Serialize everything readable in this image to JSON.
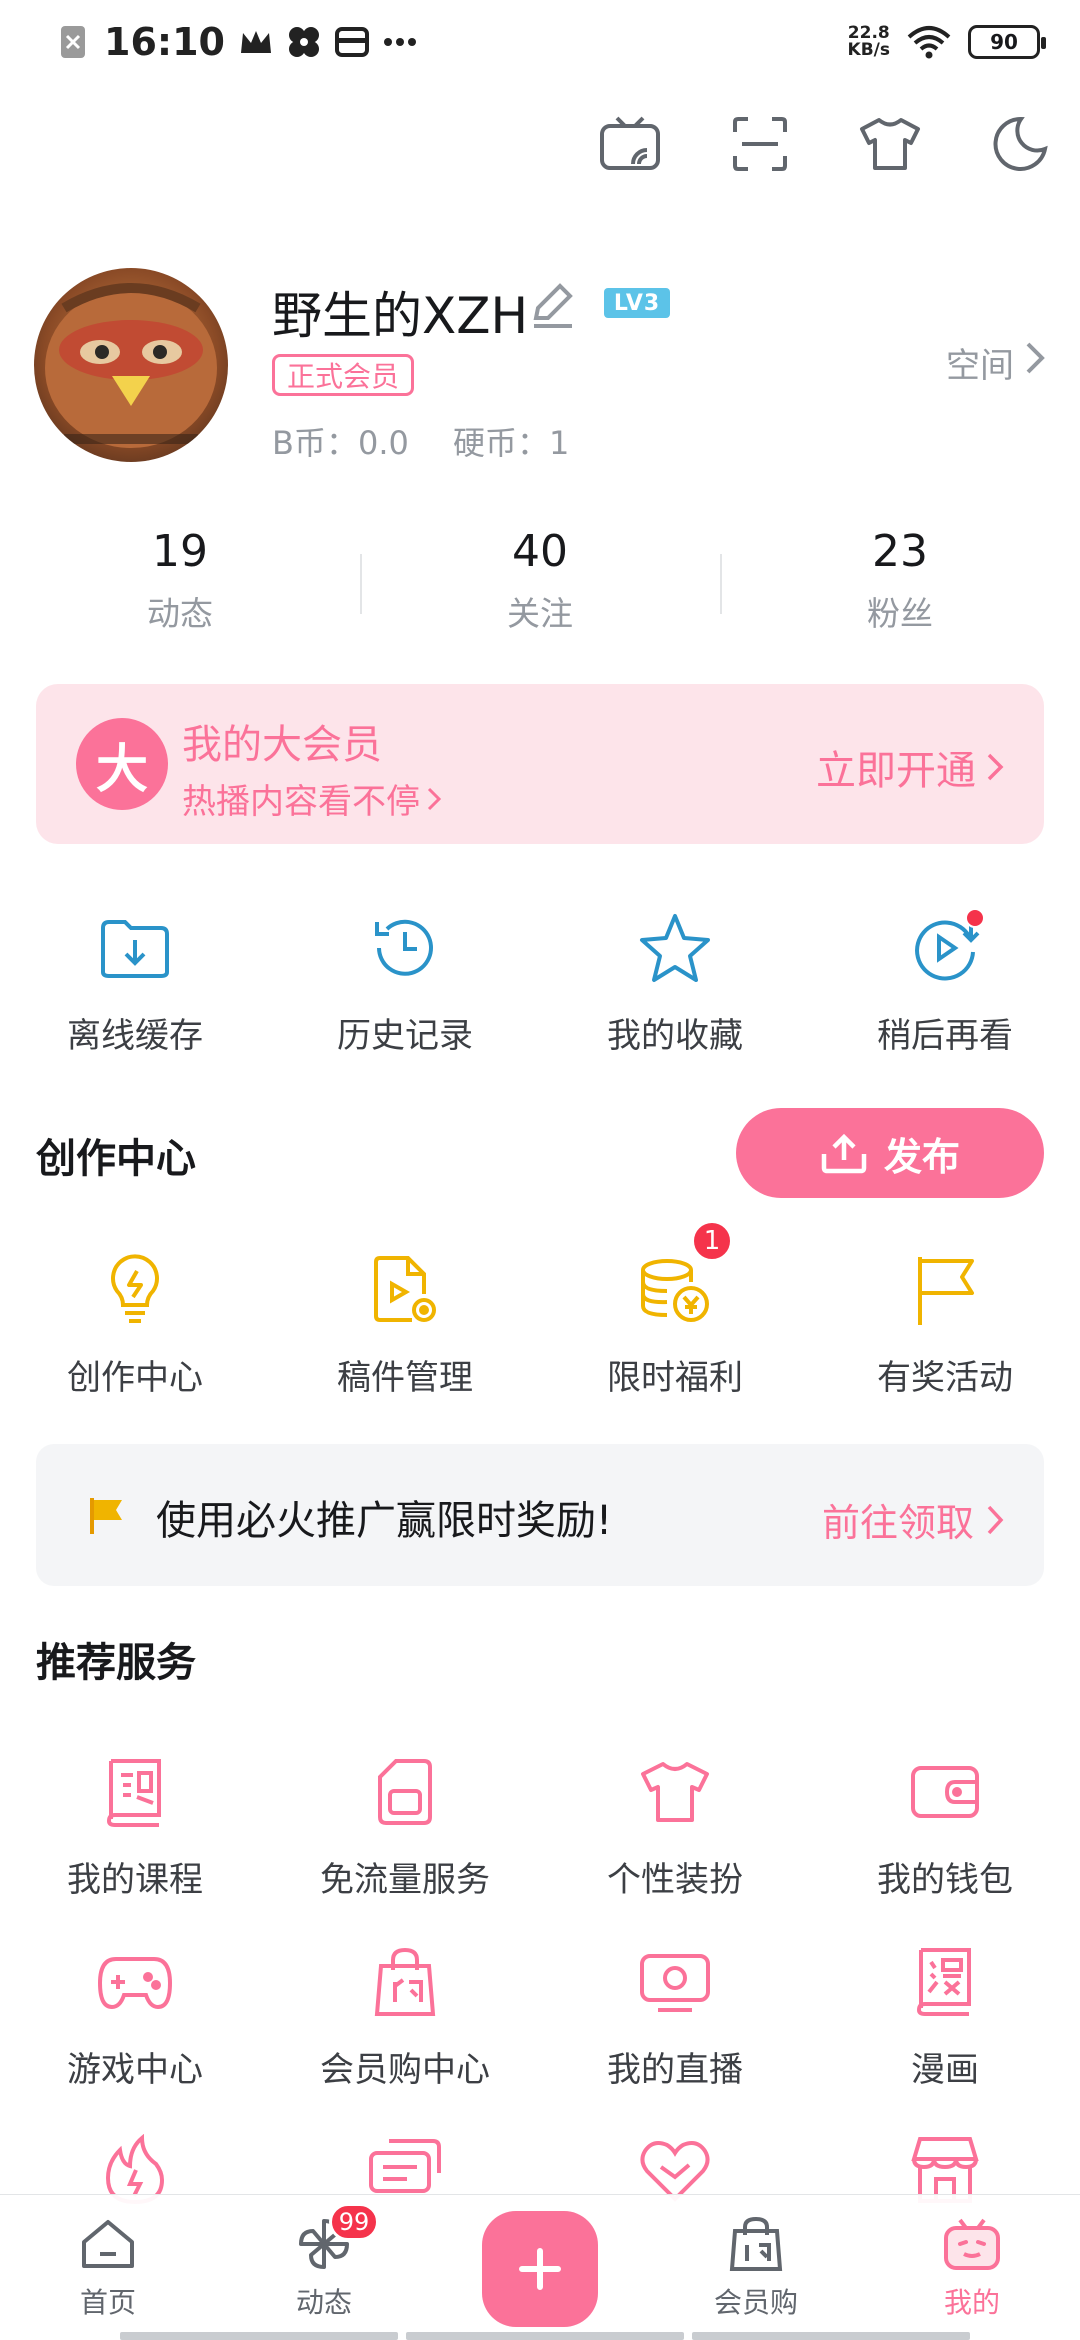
{
  "status_bar": {
    "time": "16:10",
    "net_speed_value": "22.8",
    "net_speed_unit": "KB/s",
    "battery": "90"
  },
  "top_actions": [
    "tv-cast-icon",
    "scan-icon",
    "tshirt-icon",
    "night-mode-icon"
  ],
  "profile": {
    "username": "野生的XZH",
    "level": "LV3",
    "member_tag": "正式会员",
    "b_coins": "B币：0.0",
    "coins": "硬币：1",
    "space_link": "空间"
  },
  "stats": [
    {
      "value": "19",
      "label": "动态"
    },
    {
      "value": "40",
      "label": "关注"
    },
    {
      "value": "23",
      "label": "粉丝"
    }
  ],
  "vip": {
    "badge": "大",
    "title": "我的大会员",
    "subtitle": "热播内容看不停",
    "cta": "立即开通"
  },
  "quick_actions": [
    {
      "label": "离线缓存",
      "icon": "offline-download-icon"
    },
    {
      "label": "历史记录",
      "icon": "history-icon"
    },
    {
      "label": "我的收藏",
      "icon": "star-icon"
    },
    {
      "label": "稍后再看",
      "icon": "watch-later-icon"
    }
  ],
  "creation": {
    "title": "创作中心",
    "publish_label": "发布",
    "items": [
      {
        "label": "创作中心",
        "icon": "lightbulb-icon"
      },
      {
        "label": "稿件管理",
        "icon": "manuscript-icon"
      },
      {
        "label": "限时福利",
        "icon": "coins-icon",
        "badge": "1"
      },
      {
        "label": "有奖活动",
        "icon": "flag-icon"
      }
    ]
  },
  "promo": {
    "text": "使用必火推广赢限时奖励!",
    "cta": "前往领取"
  },
  "services": {
    "title": "推荐服务",
    "items": [
      {
        "label": "我的课程",
        "icon": "course-icon"
      },
      {
        "label": "免流量服务",
        "icon": "sim-card-icon"
      },
      {
        "label": "个性装扮",
        "icon": "tshirt-icon"
      },
      {
        "label": "我的钱包",
        "icon": "wallet-icon"
      },
      {
        "label": "游戏中心",
        "icon": "gamepad-icon"
      },
      {
        "label": "会员购中心",
        "icon": "shopping-bag-icon"
      },
      {
        "label": "我的直播",
        "icon": "live-tv-icon"
      },
      {
        "label": "漫画",
        "icon": "comic-icon"
      }
    ],
    "partial_row": [
      "fire-icon",
      "chat-icon",
      "heart-icon",
      "shop-icon"
    ]
  },
  "bottom_nav": [
    {
      "label": "首页",
      "icon": "home-icon"
    },
    {
      "label": "动态",
      "icon": "pinwheel-icon",
      "badge": "99"
    },
    {
      "label": "",
      "icon": "plus-icon"
    },
    {
      "label": "会员购",
      "icon": "shopping-bag-icon"
    },
    {
      "label": "我的",
      "icon": "tv-mascot-icon"
    }
  ],
  "colors": {
    "brand_pink": "#fb7299",
    "icon_blue": "#2a93c9",
    "icon_yellow": "#f0b400",
    "badge_red": "#f5334b",
    "text_gray": "#9499a0"
  }
}
